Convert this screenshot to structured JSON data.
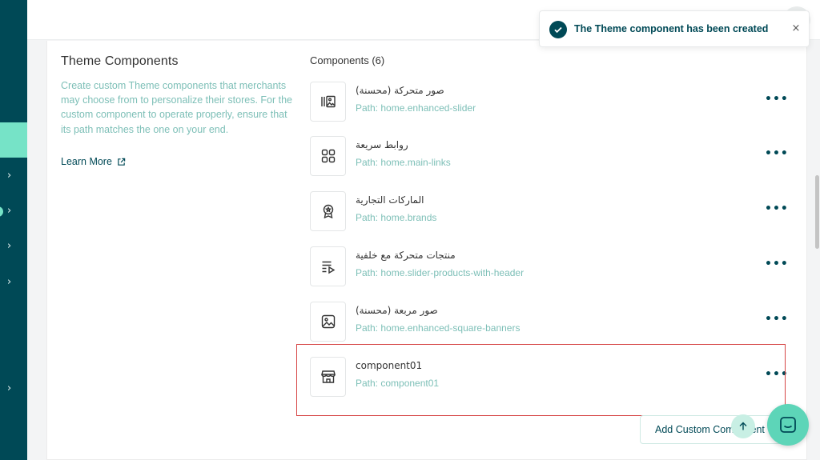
{
  "colors": {
    "sidebar": "#004956",
    "accent": "#76e3c7",
    "muted_text": "#7dbfb7",
    "highlight_border": "#d64545"
  },
  "toast": {
    "message": "The Theme component has been created",
    "icon": "check-circle-icon",
    "close_icon": "close-icon"
  },
  "info": {
    "title": "Theme Components",
    "description": "Create custom Theme components that merchants may choose from to personalize their stores. For the custom component to operate properly, ensure that its path matches the one on your end.",
    "learn_more": "Learn More"
  },
  "components": {
    "heading": "Components (6)",
    "items": [
      {
        "name": "صور متحركة (محسنة)",
        "path": "Path: home.enhanced-slider",
        "icon": "slider-images-icon"
      },
      {
        "name": "روابط سريعة",
        "path": "Path: home.main-links",
        "icon": "grid-icon"
      },
      {
        "name": "الماركات التجارية",
        "path": "Path: home.brands",
        "icon": "award-badge-icon"
      },
      {
        "name": "منتجات متحركة مع خلفية",
        "path": "Path: home.slider-products-with-header",
        "icon": "playlist-icon"
      },
      {
        "name": "صور مربعة (محسنة)",
        "path": "Path: home.enhanced-square-banners",
        "icon": "image-icon"
      },
      {
        "name": "component01",
        "path": "Path: component01",
        "icon": "store-icon"
      }
    ]
  },
  "add_button": {
    "label": "Add Custom Component"
  }
}
